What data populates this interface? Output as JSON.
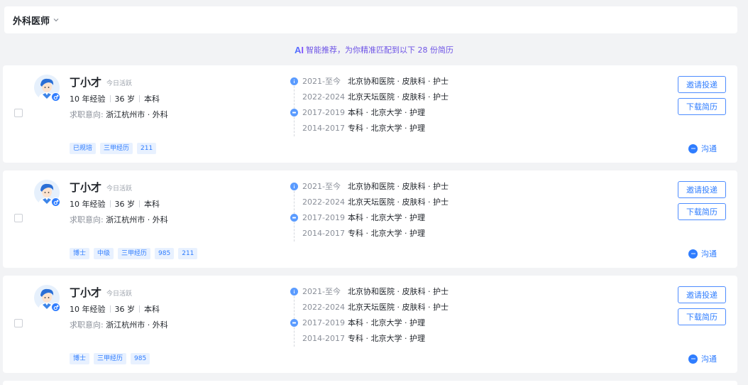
{
  "header": {
    "title": "外科医师"
  },
  "ai_banner": {
    "mark": "AI",
    "text": "智能推荐，为你精准匹配到以下 28 份简历"
  },
  "colors": {
    "accent": "#2f7dff",
    "ai_purple": "#6e54e6",
    "tag_bg": "#e8f1ff"
  },
  "actions": {
    "invite": "邀请投递",
    "download": "下载简历",
    "chat": "沟通"
  },
  "candidates": [
    {
      "name": "丁小才",
      "active": "今日活跃",
      "experience": "10 年经验",
      "age": "36 岁",
      "degree": "本科",
      "intent_label": "求职意向:",
      "intent_value": "浙江杭州市 · 外科",
      "timeline": [
        {
          "icon": "work-icon",
          "date": "2021-至今",
          "text": "北京协和医院 · 皮肤科 · 护士"
        },
        {
          "icon": "",
          "date": "2022-2024",
          "text": "北京天坛医院 · 皮肤科 · 护士"
        },
        {
          "icon": "education-icon",
          "date": "2017-2019",
          "text": "本科 · 北京大学 · 护理"
        },
        {
          "icon": "",
          "date": "2014-2017",
          "text": "专科 · 北京大学 · 护理"
        }
      ],
      "tags": [
        "已规培",
        "三甲经历",
        "211"
      ]
    },
    {
      "name": "丁小才",
      "active": "今日活跃",
      "experience": "10 年经验",
      "age": "36 岁",
      "degree": "本科",
      "intent_label": "求职意向:",
      "intent_value": "浙江杭州市 · 外科",
      "timeline": [
        {
          "icon": "work-icon",
          "date": "2021-至今",
          "text": "北京协和医院 · 皮肤科 · 护士"
        },
        {
          "icon": "",
          "date": "2022-2024",
          "text": "北京天坛医院 · 皮肤科 · 护士"
        },
        {
          "icon": "education-icon",
          "date": "2017-2019",
          "text": "本科 · 北京大学 · 护理"
        },
        {
          "icon": "",
          "date": "2014-2017",
          "text": "专科 · 北京大学 · 护理"
        }
      ],
      "tags": [
        "博士",
        "中级",
        "三甲经历",
        "985",
        "211"
      ]
    },
    {
      "name": "丁小才",
      "active": "今日活跃",
      "experience": "10 年经验",
      "age": "36 岁",
      "degree": "本科",
      "intent_label": "求职意向:",
      "intent_value": "浙江杭州市 · 外科",
      "timeline": [
        {
          "icon": "work-icon",
          "date": "2021-至今",
          "text": "北京协和医院 · 皮肤科 · 护士"
        },
        {
          "icon": "",
          "date": "2022-2024",
          "text": "北京天坛医院 · 皮肤科 · 护士"
        },
        {
          "icon": "education-icon",
          "date": "2017-2019",
          "text": "本科 · 北京大学 · 护理"
        },
        {
          "icon": "",
          "date": "2014-2017",
          "text": "专科 · 北京大学 · 护理"
        }
      ],
      "tags": [
        "博士",
        "三甲经历",
        "985"
      ]
    }
  ]
}
